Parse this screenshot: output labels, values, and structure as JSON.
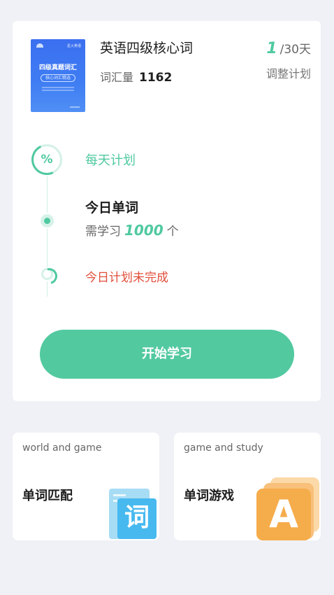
{
  "plan_card": {
    "book": {
      "cover_title": "四级真题词汇",
      "cover_subtitle": "核心词汇精选",
      "cover_tag": "星火英语",
      "title": "英语四级核心词",
      "vocab_label": "词汇量",
      "vocab_count": "1162"
    },
    "progress": {
      "current_day": "1",
      "total_label": "/30天",
      "adjust_label": "调整计划"
    },
    "timeline": {
      "daily_plan_label": "每天计划",
      "percent_glyph": "%",
      "today_words_title": "今日单词",
      "need_prefix": "需学习",
      "need_count": "1000",
      "need_unit": "个",
      "status_text": "今日计划未完成"
    },
    "start_button_label": "开始学习"
  },
  "mini_cards": [
    {
      "subtitle": "world and game",
      "title": "单词匹配",
      "icon_char": "词"
    },
    {
      "subtitle": "game and study",
      "title": "单词游戏",
      "icon_char": "A"
    }
  ],
  "colors": {
    "accent": "#52c99f",
    "alert": "#e04e3a",
    "background": "#f0f1f6",
    "card": "#ffffff",
    "book_cover": "#3f7df3",
    "word_icon": "#47b9ef",
    "game_icon": "#f5ac4b"
  },
  "icons": [
    "percent-icon",
    "progress-dot-icon",
    "loading-spinner-icon",
    "word-card-icon",
    "letter-a-cards-icon"
  ]
}
